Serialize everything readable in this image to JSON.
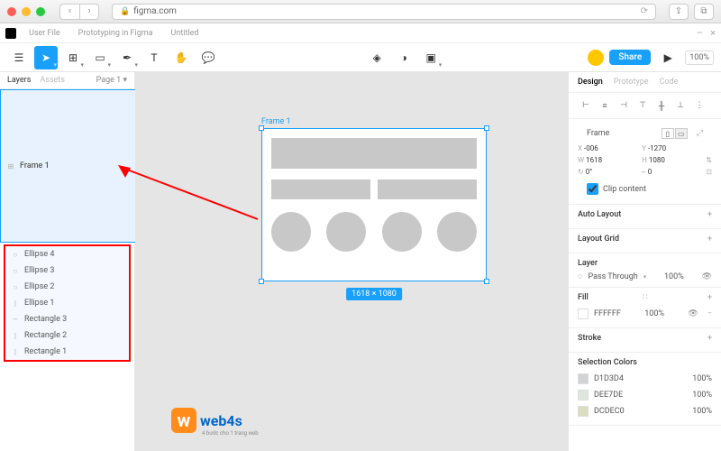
{
  "browser": {
    "url": "figma.com"
  },
  "tabs": {
    "t1": "User File",
    "t2": "Prototyping in Figma",
    "t3": "Untitled"
  },
  "window": {
    "minus": "–",
    "close": "×"
  },
  "toolbar": {
    "share_label": "Share",
    "zoom": "100%"
  },
  "left": {
    "tab_layers": "Layers",
    "tab_assets": "Assets",
    "pages": "Page 1",
    "frame_label": "Frame 1",
    "items": [
      {
        "icon": "○",
        "label": "Ellipse 4"
      },
      {
        "icon": "○",
        "label": "Ellipse 3"
      },
      {
        "icon": "○",
        "label": "Ellipse 2"
      },
      {
        "icon": "|",
        "label": "Ellipse 1"
      },
      {
        "icon": "—",
        "label": "Rectangle 3"
      },
      {
        "icon": "|",
        "label": "Rectangle 2"
      },
      {
        "icon": "|",
        "label": "Rectangle 1"
      }
    ]
  },
  "canvas": {
    "frame_name": "Frame 1",
    "dimensions": "1618 × 1080"
  },
  "right": {
    "tab_design": "Design",
    "tab_prototype": "Prototype",
    "tab_code": "Code",
    "frame_label": "Frame",
    "x_label": "X",
    "x_val": "-006",
    "y_label": "Y",
    "y_val": "-1270",
    "w_label": "W",
    "w_val": "1618",
    "h_label": "H",
    "h_val": "1080",
    "r_label": "↻",
    "r_val": "0°",
    "c_label": "⌐",
    "c_val": "0",
    "clip_label": "Clip content",
    "auto_layout": "Auto Layout",
    "layout_grid": "Layout Grid",
    "layer_title": "Layer",
    "blend_mode": "Pass Through",
    "blend_opacity": "100%",
    "fill_title": "Fill",
    "fill_hex": "FFFFFF",
    "fill_opacity": "100%",
    "stroke_title": "Stroke",
    "selcolors_title": "Selection Colors",
    "selcolors": [
      {
        "hex": "D1D3D4",
        "op": "100%"
      },
      {
        "hex": "DEE7DE",
        "op": "100%"
      },
      {
        "hex": "DCDEC0",
        "op": "100%"
      }
    ]
  },
  "brand": {
    "icon": "w",
    "name": "web4s",
    "tag": "4 bước cho 1 trang web"
  }
}
